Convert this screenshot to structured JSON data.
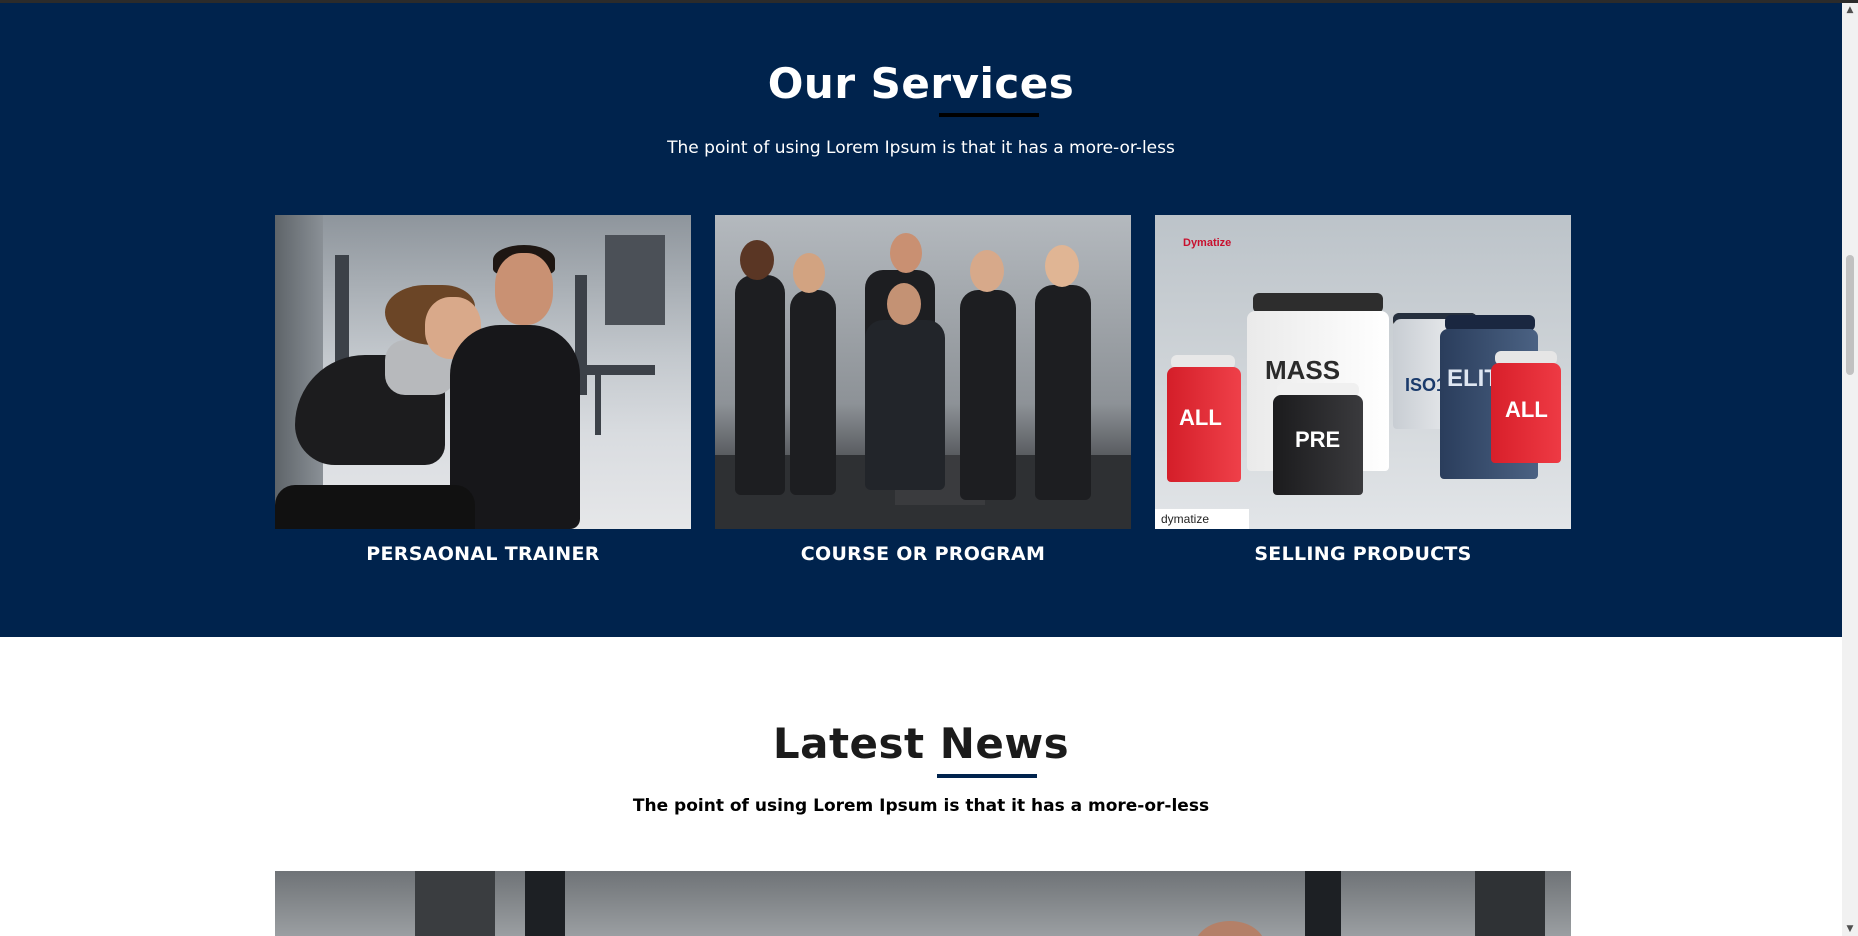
{
  "services": {
    "title": "Our Services",
    "subtitle": "The point of using Lorem Ipsum is that it has a more-or-less",
    "cards": [
      {
        "label": "PERSAONAL TRAINER",
        "image": "gym-trainer-photo"
      },
      {
        "label": "COURSE OR PROGRAM",
        "image": "fitness-team-photo"
      },
      {
        "label": "SELLING PRODUCTS",
        "image": "supplement-products-photo"
      }
    ],
    "product_brand": "Dymatize",
    "product_badge": "dymatize",
    "product_labels": [
      "MASS",
      "ELITE",
      "ISO100",
      "PRE",
      "ALL"
    ]
  },
  "news": {
    "title": "Latest News",
    "subtitle": "The point of using Lorem Ipsum is that it has a more-or-less"
  },
  "colors": {
    "primary_navy": "#00234d",
    "white": "#ffffff",
    "text_dark": "#1b1b1b"
  }
}
